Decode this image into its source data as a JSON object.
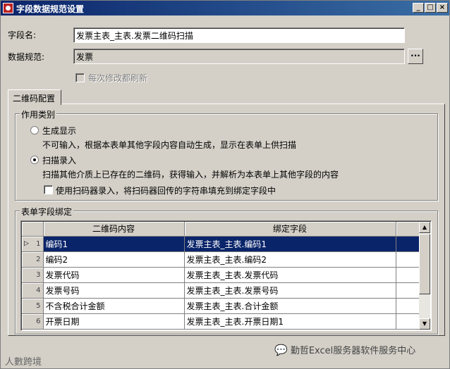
{
  "window": {
    "title": "字段数据规范设置"
  },
  "form": {
    "field_name_label": "字段名:",
    "field_name_value": "发票主表_主表.发票二维码扫描",
    "data_spec_label": "数据规范:",
    "data_spec_value": "发票",
    "browse_label": "···",
    "refresh_label": "每次修改都刷新"
  },
  "tabs": [
    {
      "label": "二维码配置"
    }
  ],
  "usage": {
    "title": "作用类别",
    "option1_label": "生成显示",
    "option1_desc": "不可输入，根据本表单其他字段内容自动生成，显示在表单上供扫描",
    "option2_label": "扫描录入",
    "option2_desc": "扫描其他介质上已存在的二维码，获得输入，并解析为本表单上其他字段的内容",
    "scanner_label": "使用扫码器录入，将扫码器回传的字符串填充到绑定字段中",
    "selected": "扫描录入"
  },
  "binding": {
    "title": "表单字段绑定",
    "columns": [
      "二维码内容",
      "绑定字段"
    ],
    "rows": [
      {
        "no": "1",
        "content": "编码1",
        "field": "发票主表_主表.编码1"
      },
      {
        "no": "2",
        "content": "编码2",
        "field": "发票主表_主表.编码2"
      },
      {
        "no": "3",
        "content": "发票代码",
        "field": "发票主表_主表.发票代码"
      },
      {
        "no": "4",
        "content": "发票号码",
        "field": "发票主表_主表.发票号码"
      },
      {
        "no": "5",
        "content": "不含税合计金额",
        "field": "发票主表_主表.合计金额"
      },
      {
        "no": "6",
        "content": "开票日期",
        "field": "发票主表_主表.开票日期1"
      }
    ]
  },
  "watermarks": {
    "left": "人數跨境",
    "right": "勤哲Excel服务器软件服务中心"
  }
}
